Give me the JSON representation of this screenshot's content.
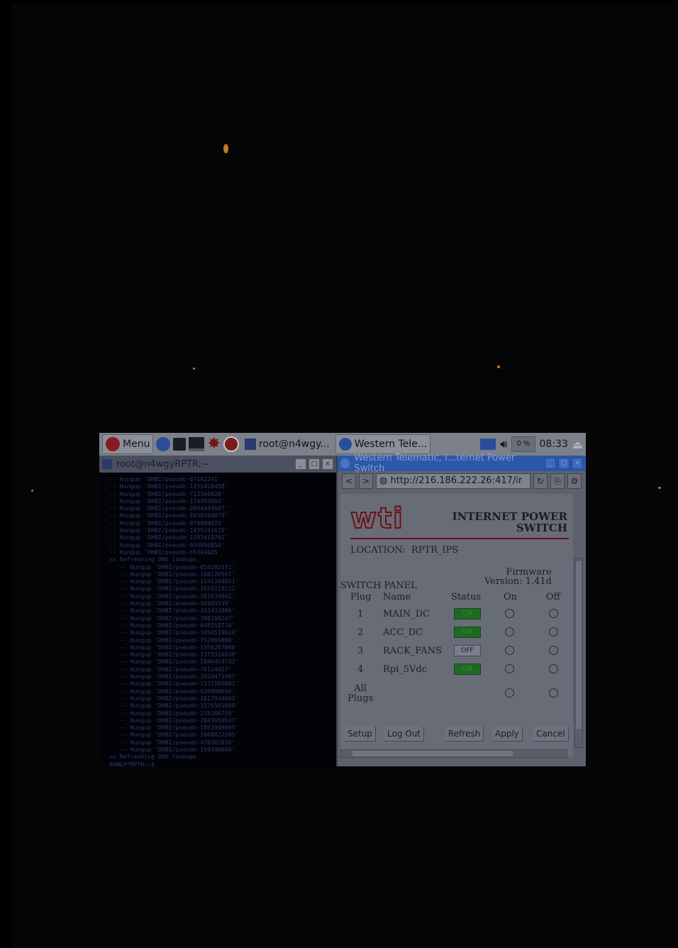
{
  "taskbar": {
    "menu_label": "Menu",
    "task1_label": "root@n4wgy...",
    "task2_label": "Western Tele...",
    "cpu_label": "0 %",
    "clock": "08:33",
    "icons": [
      "raspberry-icon",
      "globe-icon",
      "folder-icon",
      "monitor-icon",
      "burst-icon",
      "wolfram-icon",
      "terminal-icon",
      "browser-icon",
      "network-icon",
      "volume-icon",
      "eject-icon"
    ]
  },
  "terminal": {
    "title": "root@n4wgyRPTR:~",
    "lines": [
      "-- Hunguo 'DHBI/pseudo-67192241",
      "-- Hungup 'DHBI/pseudo-1331426458'",
      "-- Hungup 'DHBI/pseudo-722360020'",
      "-- Hungup 'DHBI/pseudo-174993864'",
      "-- Hungup 'DHBI/pseudo-2044444607'",
      "-- Hungup 'DHBI/pseudo-1036104879'",
      "-- Hungup 'DHBI/pseudo-974004079'",
      "-- Hungup 'DHBI/pseudo-1435241615'",
      "-- Hungup 'DHBI/pseudo-1293419702'",
      "-- Hungup 'DHBI/pseudo-659994854'",
      "-- Hungup 'DHBI/pseudo-65344685",
      "== Refreshing DNS lookups.",
      "   -- Hungup 'DHBI/pseudo-654285172'",
      "   -- Hungup 'DHBI/pseudo-188226561'",
      "   -- Hungup 'DHBI/pseudo-1141244051'",
      "   -- Hungup 'DHBI/pseudo-1659219211'",
      "   -- Hungup 'DHBI/pseudo-761634942'",
      "   -- Hungup 'DHBI/pseudo-56993539'",
      "   -- Hungup 'DHBI/pseudo-103432086'",
      "   -- Hungup 'DHBI/pseudo-388160247'",
      "   -- Hungup 'DHBI/pseudo-698555710'",
      "   -- Hungup 'DHBI/pseudo-1054519618'",
      "   -- Hungup 'DHBI/pseudo-752066888'",
      "   -- Hungup 'DHBI/pseudo-1550267860'",
      "   -- Hungup 'DHBI/pseudo-1375326838'",
      "   -- Hungup 'DHBI/pseudo-1840454733'",
      "   -- Hungup 'DHBI/pseudo-76124457'",
      "   -- Hungup 'DHBI/pseudo-1024471987'",
      "   -- Hungup 'DHBI/pseudo-1172105081'",
      "   -- Hungup 'DHBI/pseudo-920998696'",
      "   -- Hungup 'DHBI/pseudo-1017934003'",
      "   -- Hungup 'DHBI/pseudo-1576581009'",
      "   -- Hungup 'DHBI/pseudo-210266759'",
      "   -- Hungup 'DHBI/pseudo-2043056547'",
      "   -- Hungup 'DHBI/pseudo-1853949095'",
      "   -- Hungup 'DHBI/pseudo-1068822205'",
      "   -- Hungup 'DHBI/pseudo-470365816'",
      "   -- Hungup 'DHBI/pseudo-159340694'",
      "== Refreshing DNS lookups.",
      "N4WGY*RPTR:~$"
    ]
  },
  "browser": {
    "title": "Western Telematic, I...ternet Power Switch",
    "url": "http://216.186.222.26:417/ir",
    "page": {
      "logo": "wti",
      "heading_line1": "INTERNET POWER",
      "heading_line2": "SWITCH",
      "location": "LOCATION:  RPTR_IPS",
      "firmware_line1": "Firmware",
      "firmware_line2": "Version: 1.41d",
      "switch_panel": "SWITCH PANEL",
      "col_plug": "Plug",
      "col_name": "Name",
      "col_status": "Status",
      "col_on": "On",
      "col_off": "Off",
      "rows": [
        {
          "plug": "1",
          "name": "MAIN_DC",
          "status": "ON"
        },
        {
          "plug": "2",
          "name": "ACC_DC",
          "status": "ON"
        },
        {
          "plug": "3",
          "name": "RACK_FANS",
          "status": "OFF"
        },
        {
          "plug": "4",
          "name": "Rpi_5Vdc",
          "status": "ON"
        }
      ],
      "all_label_1": "All",
      "all_label_2": "Plugs",
      "buttons": {
        "setup": "Setup",
        "logout": "Log Out",
        "refresh": "Refresh",
        "apply": "Apply",
        "cancel": "Cancel"
      }
    }
  },
  "colors": {
    "background": "#000000",
    "taskbar": "#7c8089",
    "browser_title": "#2b58a8",
    "status_on": "#1e6a24",
    "logo_red": "#6e1016"
  }
}
